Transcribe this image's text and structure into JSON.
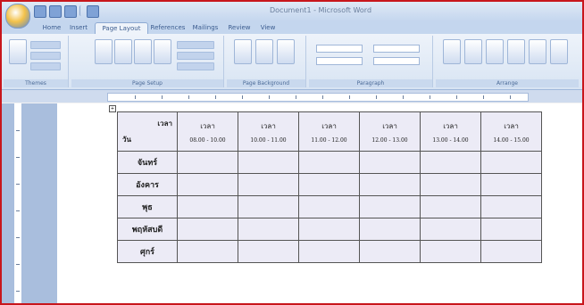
{
  "window": {
    "title": "Document1 - Microsoft Word"
  },
  "tabs": [
    {
      "label": "Home"
    },
    {
      "label": "Insert"
    },
    {
      "label": "Page Layout"
    },
    {
      "label": "References"
    },
    {
      "label": "Mailings"
    },
    {
      "label": "Review"
    },
    {
      "label": "View"
    }
  ],
  "ribbon": {
    "groups": [
      {
        "label": "Themes"
      },
      {
        "label": "Page Setup"
      },
      {
        "label": "Page Background"
      },
      {
        "label": "Paragraph"
      },
      {
        "label": "Arrange"
      }
    ]
  },
  "timetable": {
    "header_corner_top": "เวลา",
    "header_corner_bottom": "วัน",
    "columns": [
      {
        "title": "เวลา",
        "time": "08.00 - 10.00"
      },
      {
        "title": "เวลา",
        "time": "10.00 - 11.00"
      },
      {
        "title": "เวลา",
        "time": "11.00 - 12.00"
      },
      {
        "title": "เวลา",
        "time": "12.00 - 13.00"
      },
      {
        "title": "เวลา",
        "time": "13.00 - 14.00"
      },
      {
        "title": "เวลา",
        "time": "14.00 - 15.00"
      }
    ],
    "rows": [
      {
        "day": "จันทร์"
      },
      {
        "day": "อังคาร"
      },
      {
        "day": "พุธ"
      },
      {
        "day": "พฤหัสบดี"
      },
      {
        "day": "ศุกร์"
      }
    ]
  },
  "icons": {
    "office_button": "office-logo-icon",
    "qat": [
      "save-icon",
      "undo-icon",
      "redo-icon",
      "customize-icon"
    ]
  }
}
